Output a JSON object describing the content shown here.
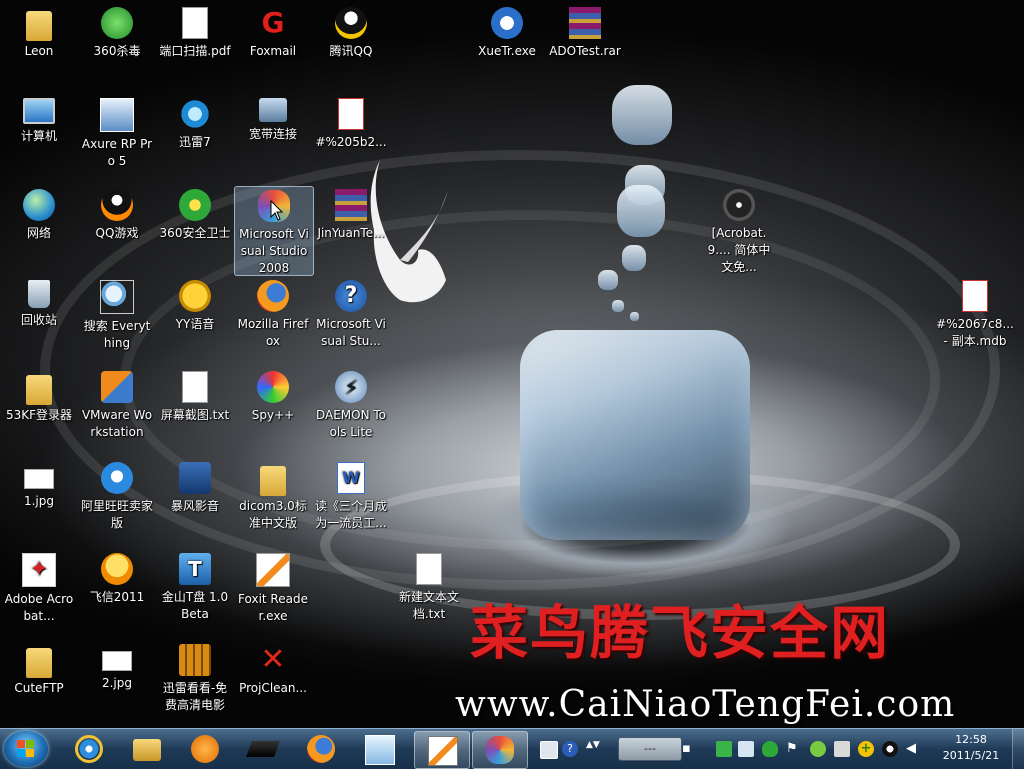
{
  "desktop": {
    "icons": [
      {
        "label": "Leon"
      },
      {
        "label": "360杀毒"
      },
      {
        "label": "端口扫描.pdf"
      },
      {
        "label": "Foxmail"
      },
      {
        "label": "腾讯QQ"
      },
      {
        "label": "XueTr.exe"
      },
      {
        "label": "ADOTest.rar"
      },
      {
        "label": "计算机"
      },
      {
        "label": "Axure RP Pro 5"
      },
      {
        "label": "迅雷7"
      },
      {
        "label": "宽带连接"
      },
      {
        "label": "#%205b2..."
      },
      {
        "label": "网络"
      },
      {
        "label": "QQ游戏"
      },
      {
        "label": "360安全卫士"
      },
      {
        "label": "Microsoft Visual Studio 2008"
      },
      {
        "label": "JinYuanTe..."
      },
      {
        "label": "[Acrobat.9.... 简体中文免..."
      },
      {
        "label": "回收站"
      },
      {
        "label": "搜索 Everything"
      },
      {
        "label": "YY语音"
      },
      {
        "label": "Mozilla Firefox"
      },
      {
        "label": "Microsoft Visual Stu..."
      },
      {
        "label": "#%2067c8... - 副本.mdb"
      },
      {
        "label": "53KF登录器"
      },
      {
        "label": "VMware Workstation"
      },
      {
        "label": "屏幕截图.txt"
      },
      {
        "label": "Spy++"
      },
      {
        "label": "DAEMON Tools Lite"
      },
      {
        "label": "1.jpg"
      },
      {
        "label": "阿里旺旺卖家版"
      },
      {
        "label": "暴风影音"
      },
      {
        "label": "dicom3.0标准中文版"
      },
      {
        "label": "读《三个月成为一流员工..."
      },
      {
        "label": "Adobe Acrobat..."
      },
      {
        "label": "飞信2011"
      },
      {
        "label": "金山T盘 1.0Beta"
      },
      {
        "label": "Foxit Reader.exe"
      },
      {
        "label": "新建文本文档.txt"
      },
      {
        "label": "CuteFTP"
      },
      {
        "label": "2.jpg"
      },
      {
        "label": "迅雷看看-免费高清电影"
      },
      {
        "label": "ProjClean..."
      }
    ],
    "wallpaper": {
      "title_cn": "菜鸟腾飞安全网",
      "url": "www.CaiNiaoTengFei.com"
    }
  },
  "taskbar": {
    "pinned": [
      {
        "icon": "internet-explorer-icon"
      },
      {
        "icon": "file-explorer-icon"
      },
      {
        "icon": "media-player-icon"
      },
      {
        "icon": "laptop-icon"
      },
      {
        "icon": "firefox-icon"
      },
      {
        "icon": "notepad-icon"
      },
      {
        "icon": "foxit-reader-icon"
      },
      {
        "icon": "visual-studio-icon"
      }
    ],
    "battery_text": "---",
    "clock": {
      "time": "12:58",
      "date": "2011/5/21"
    }
  }
}
